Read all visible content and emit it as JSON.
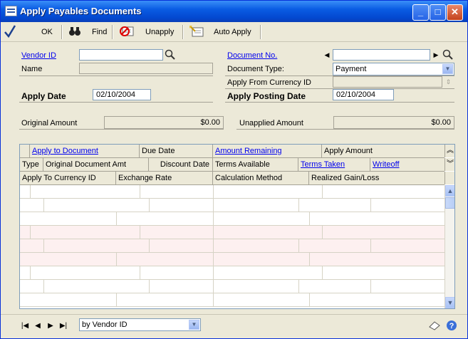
{
  "window": {
    "title": "Apply Payables Documents"
  },
  "toolbar": {
    "ok_label": "OK",
    "find_label": "Find",
    "unapply_label": "Unapply",
    "auto_apply_label": "Auto Apply"
  },
  "form": {
    "vendor_id_label": "Vendor ID",
    "vendor_id_value": "",
    "name_label": "Name",
    "name_value": "",
    "apply_date_label": "Apply Date",
    "apply_date_value": "02/10/2004",
    "document_no_label": "Document No.",
    "document_no_value": "",
    "document_type_label": "Document Type:",
    "document_type_value": "Payment",
    "apply_from_currency_label": "Apply From Currency ID",
    "apply_from_currency_value": "",
    "apply_posting_date_label": "Apply Posting Date",
    "apply_posting_date_value": "02/10/2004",
    "original_amount_label": "Original Amount",
    "original_amount_value": "$0.00",
    "unapplied_amount_label": "Unapplied Amount",
    "unapplied_amount_value": "$0.00"
  },
  "grid": {
    "header1": [
      "Apply to Document",
      "Due Date",
      "Amount Remaining",
      "Apply Amount"
    ],
    "header2": [
      "Type",
      "Original Document Amt",
      "Discount Date",
      "Terms Available",
      "Terms Taken",
      "Writeoff"
    ],
    "header3": [
      "Apply To Currency ID",
      "Exchange Rate",
      "Calculation Method",
      "Realized Gain/Loss"
    ]
  },
  "statusbar": {
    "sort_value": "by Vendor ID"
  },
  "colors": {
    "title_bar": "#0a5ce3",
    "link": "#0000ee",
    "face": "#ece9d8"
  },
  "icons": [
    "checkmark-icon",
    "binoculars-icon",
    "unapply-icon",
    "auto-apply-icon",
    "lookup-icon",
    "note-icon",
    "help-icon"
  ]
}
